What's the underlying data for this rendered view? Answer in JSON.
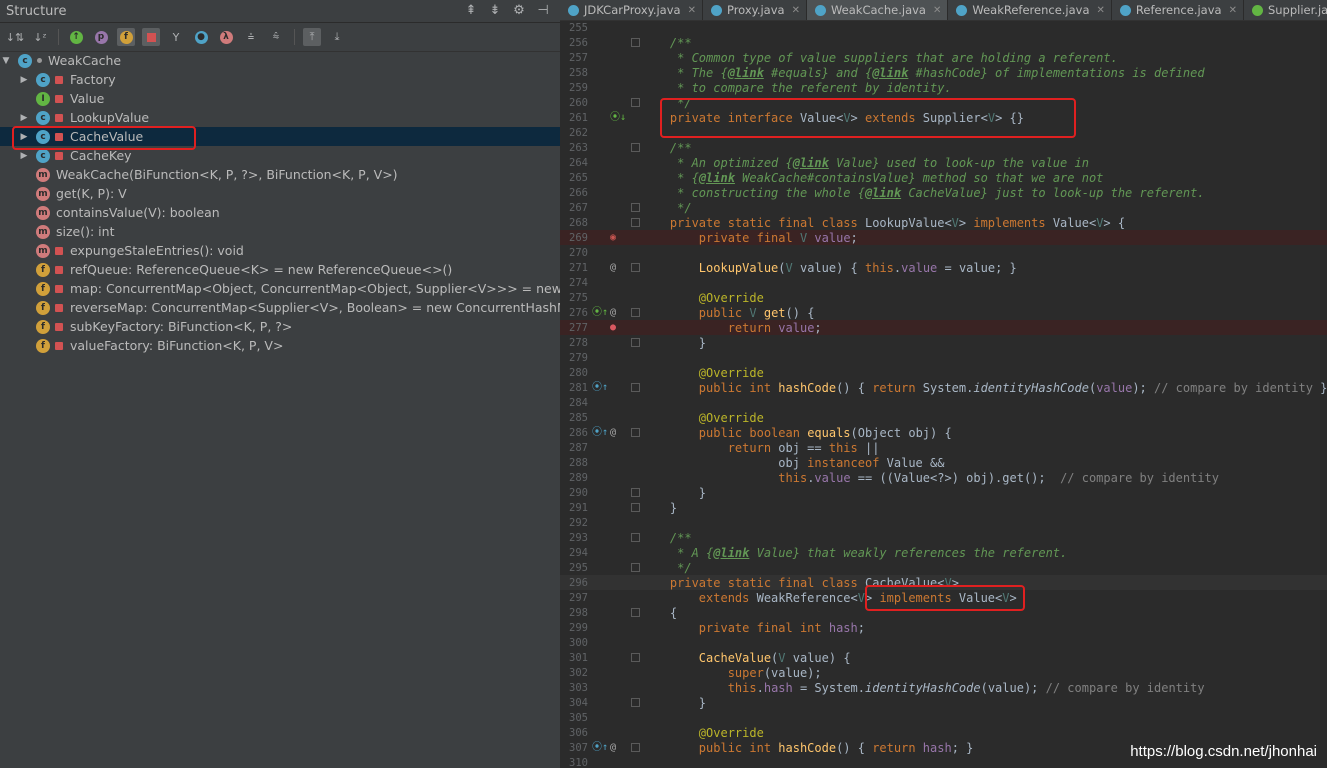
{
  "structure": {
    "title": "Structure",
    "root": "WeakCache",
    "items": [
      {
        "label": "Factory",
        "icon": "class-icon",
        "arrow": "▶"
      },
      {
        "label": "Value",
        "icon": "interface-icon",
        "arrow": ""
      },
      {
        "label": "LookupValue",
        "icon": "class-icon",
        "arrow": "▶"
      },
      {
        "label": "CacheValue",
        "icon": "class-icon",
        "arrow": "▶"
      },
      {
        "label": "CacheKey",
        "icon": "class-icon",
        "arrow": "▶"
      },
      {
        "label": "WeakCache(BiFunction<K, P, ?>, BiFunction<K, P, V>)",
        "icon": "method-icon"
      },
      {
        "label": "get(K, P): V",
        "icon": "method-icon"
      },
      {
        "label": "containsValue(V): boolean",
        "icon": "method-icon"
      },
      {
        "label": "size(): int",
        "icon": "method-icon"
      },
      {
        "label": "expungeStaleEntries(): void",
        "icon": "method-icon"
      },
      {
        "label": "refQueue: ReferenceQueue<K> = new ReferenceQueue<>()",
        "icon": "field-icon"
      },
      {
        "label": "map: ConcurrentMap<Object, ConcurrentMap<Object, Supplier<V>>> = new Co",
        "icon": "field-icon"
      },
      {
        "label": "reverseMap: ConcurrentMap<Supplier<V>, Boolean> = new ConcurrentHashMa",
        "icon": "field-icon"
      },
      {
        "label": "subKeyFactory: BiFunction<K, P, ?>",
        "icon": "field-icon"
      },
      {
        "label": "valueFactory: BiFunction<K, P, V>",
        "icon": "field-icon"
      }
    ]
  },
  "tabs": [
    {
      "label": "JDKCarProxy.java",
      "icon": "class-icon"
    },
    {
      "label": "Proxy.java",
      "icon": "class-icon"
    },
    {
      "label": "WeakCache.java",
      "icon": "class-icon"
    },
    {
      "label": "WeakReference.java",
      "icon": "class-icon"
    },
    {
      "label": "Reference.java",
      "icon": "class-icon"
    },
    {
      "label": "Supplier.java",
      "icon": "interface-icon"
    }
  ],
  "active_tab": "WeakCache.java",
  "line_numbers": [
    "255",
    "256",
    "257",
    "258",
    "259",
    "260",
    "261",
    "262",
    "263",
    "264",
    "265",
    "266",
    "267",
    "268",
    "269",
    "270",
    "271",
    "274",
    "275",
    "276",
    "277",
    "278",
    "279",
    "280",
    "281",
    "284",
    "285",
    "286",
    "287",
    "288",
    "289",
    "290",
    "291",
    "292",
    "293",
    "294",
    "295",
    "296",
    "297",
    "298",
    "299",
    "300",
    "301",
    "302",
    "303",
    "304",
    "305",
    "306",
    "307",
    "310"
  ],
  "watermark": "https://blog.csdn.net/jhonhai",
  "colors": {
    "keyword": "#cc7832",
    "comment": "#629755",
    "annotation": "#bbb529",
    "highlight_box": "#e02020"
  }
}
